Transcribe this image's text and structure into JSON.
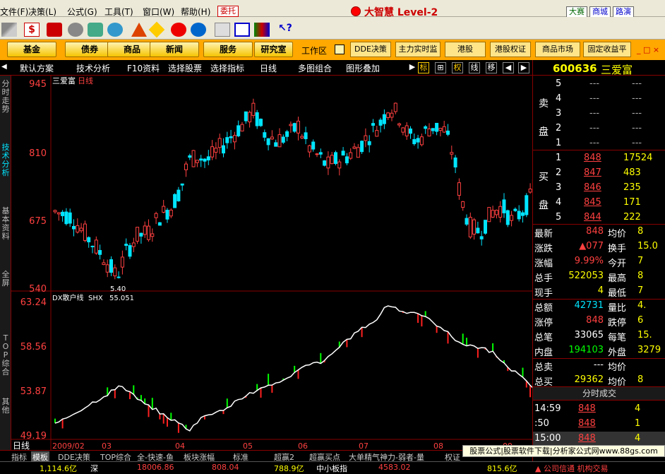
{
  "menu": {
    "items": [
      "文件(F)",
      "决策(L)",
      "公式(G)",
      "工具(T)",
      "窗口(W)",
      "帮助(H)"
    ],
    "wt_button": "委托",
    "brand": "大智慧 Level-2",
    "right_buttons": [
      "大赛",
      "商城",
      "路演"
    ]
  },
  "categories": {
    "main": [
      "基金",
      "债券",
      "商品",
      "新闻",
      "服务",
      "研究室"
    ],
    "workarea_label": "工作区",
    "tabs": [
      "DDE决策",
      "主力实时监",
      "港股",
      "港股权证",
      "商品市场",
      "固定收益平"
    ]
  },
  "subbar": {
    "items": [
      "默认方案",
      "技术分析",
      "F10资料",
      "选择股票",
      "选择指标",
      "日线",
      "多图组合",
      "图形叠加"
    ],
    "icons": [
      "标",
      "⊞",
      "权",
      "线",
      "移"
    ]
  },
  "leftside": [
    "分时走势",
    "技术分析",
    "基本资料",
    "全屏",
    "TOP综合",
    "其他"
  ],
  "chart": {
    "main_title": "三爱富",
    "period": "日线",
    "upper_y_labels": [
      "945",
      "810",
      "675",
      "540"
    ],
    "low_annot": "5.40",
    "indicator_title": "DX散户线",
    "indicator_name": "SHX",
    "indicator_value": "55.051",
    "lower_y_labels": [
      "63.24",
      "58.56",
      "53.87",
      "49.19"
    ],
    "x_labels": [
      "2009/02",
      "03",
      "04",
      "05",
      "06",
      "07",
      "08",
      "09"
    ],
    "period_tag": "日线"
  },
  "chart_data": {
    "type": "candlestick",
    "title": "三爱富 日线",
    "ylim": [
      540,
      945
    ],
    "x": [
      "2009/02",
      "03",
      "04",
      "05",
      "06",
      "07",
      "08",
      "09"
    ],
    "indicator": {
      "name": "DX散户线 SHX",
      "value": 55.051,
      "ylim": [
        49.19,
        63.24
      ]
    }
  },
  "quote": {
    "code": "600636",
    "name": "三爱富",
    "sell_label": "卖盘",
    "buy_label": "买盘",
    "sell": [
      {
        "lvl": "5",
        "price": "---",
        "vol": "---"
      },
      {
        "lvl": "4",
        "price": "---",
        "vol": "---"
      },
      {
        "lvl": "3",
        "price": "---",
        "vol": "---"
      },
      {
        "lvl": "2",
        "price": "---",
        "vol": "---"
      },
      {
        "lvl": "1",
        "price": "---",
        "vol": "---"
      }
    ],
    "buy": [
      {
        "lvl": "1",
        "price": "848",
        "vol": "17524"
      },
      {
        "lvl": "2",
        "price": "847",
        "vol": "483"
      },
      {
        "lvl": "3",
        "price": "846",
        "vol": "235"
      },
      {
        "lvl": "4",
        "price": "845",
        "vol": "171"
      },
      {
        "lvl": "5",
        "price": "844",
        "vol": "222"
      }
    ],
    "stats": [
      {
        "l1": "最新",
        "v1": "848",
        "c1": "red",
        "l2": "均价",
        "v2": "8"
      },
      {
        "l1": "涨跌",
        "v1": "▲077",
        "c1": "red",
        "l2": "换手",
        "v2": "15.0"
      },
      {
        "l1": "涨幅",
        "v1": "9.99%",
        "c1": "red",
        "l2": "今开",
        "v2": "7"
      },
      {
        "l1": "总手",
        "v1": "522053",
        "c1": "yel",
        "l2": "最高",
        "v2": "8"
      },
      {
        "l1": "现手",
        "v1": "4",
        "c1": "yel",
        "l2": "最低",
        "v2": "7"
      },
      {
        "l1": "总额",
        "v1": "42731",
        "c1": "cyn",
        "l2": "量比",
        "v2": "4."
      },
      {
        "l1": "涨停",
        "v1": "848",
        "c1": "red",
        "l2": "跌停",
        "v2": "6"
      },
      {
        "l1": "总笔",
        "v1": "33065",
        "c1": "wht",
        "l2": "每笔",
        "v2": "15."
      },
      {
        "l1": "内盘",
        "v1": "194103",
        "c1": "grn",
        "l2": "外盘",
        "v2": "3279"
      },
      {
        "l1": "总卖",
        "v1": "---",
        "c1": "wht",
        "l2": "均价",
        "v2": ""
      },
      {
        "l1": "总买",
        "v1": "29362",
        "c1": "yel",
        "l2": "均价",
        "v2": "8"
      }
    ],
    "ticks_title": "分时成交",
    "ticks": [
      {
        "time": "14:59",
        "price": "848",
        "vol": "4"
      },
      {
        "time": ":50",
        "price": "848",
        "vol": "1"
      },
      {
        "time": "15:00",
        "price": "848",
        "vol": "4"
      }
    ]
  },
  "bottom": {
    "tabs": [
      "指标",
      "模板",
      "DDE决策",
      "TOP综合",
      "全-快速-鱼",
      "板块涨幅",
      "标准",
      "超赢2",
      "超赢买点",
      "大单精气神力-弱者-量",
      "权证"
    ]
  },
  "ad": {
    "text": "股票公式|股票软件下载|分析家公式网www.88gs.com"
  },
  "ticker": {
    "items": [
      "1,114.6亿",
      "深",
      "18006.86",
      "808.04",
      "788.9亿",
      "中小板指",
      "4583.02",
      "815.6亿",
      "▲ 公司信通 机构交易"
    ]
  }
}
